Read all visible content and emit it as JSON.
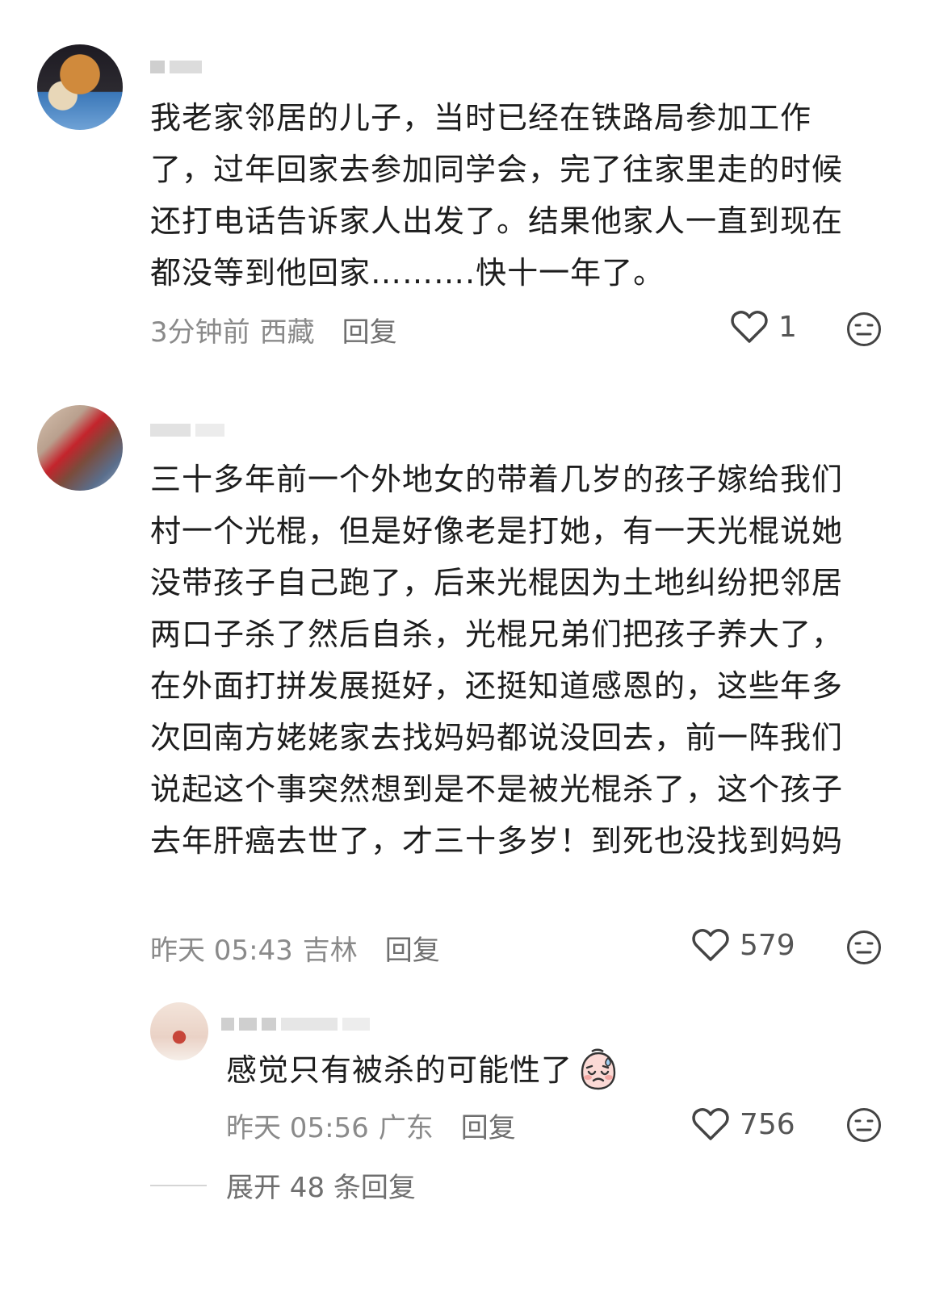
{
  "comments": [
    {
      "text": "我老家邻居的儿子，当时已经在铁路局参加工作了，过年回家去参加同学会，完了往家里走的时候还打电话告诉家人出发了。结果他家人一直到现在都没等到他回家……….快十一年了。",
      "time": "3分钟前",
      "location": "西藏",
      "reply_label": "回复",
      "likes": "1"
    },
    {
      "text": "三十多年前一个外地女的带着几岁的孩子嫁给我们村一个光棍，但是好像老是打她，有一天光棍说她没带孩子自己跑了，后来光棍因为土地纠纷把邻居两口子杀了然后自杀，光棍兄弟们把孩子养大了，在外面打拼发展挺好，还挺知道感恩的，这些年多次回南方姥姥家去找妈妈都说没回去，前一阵我们说起这个事突然想到是不是被光棍杀了，这个孩子去年肝癌去世了，才三十多岁！到死也没找到妈妈",
      "time": "昨天 05:43",
      "location": "吉林",
      "reply_label": "回复",
      "likes": "579"
    }
  ],
  "reply": {
    "text": "感觉只有被杀的可能性了",
    "time": "昨天 05:56",
    "location": "广东",
    "reply_label": "回复",
    "likes": "756"
  },
  "expand_label": "展开 48 条回复",
  "icons": {
    "like": "heart-outline-icon",
    "dislike": "neutral-face-icon",
    "emoji": "crying-face-emoji"
  }
}
